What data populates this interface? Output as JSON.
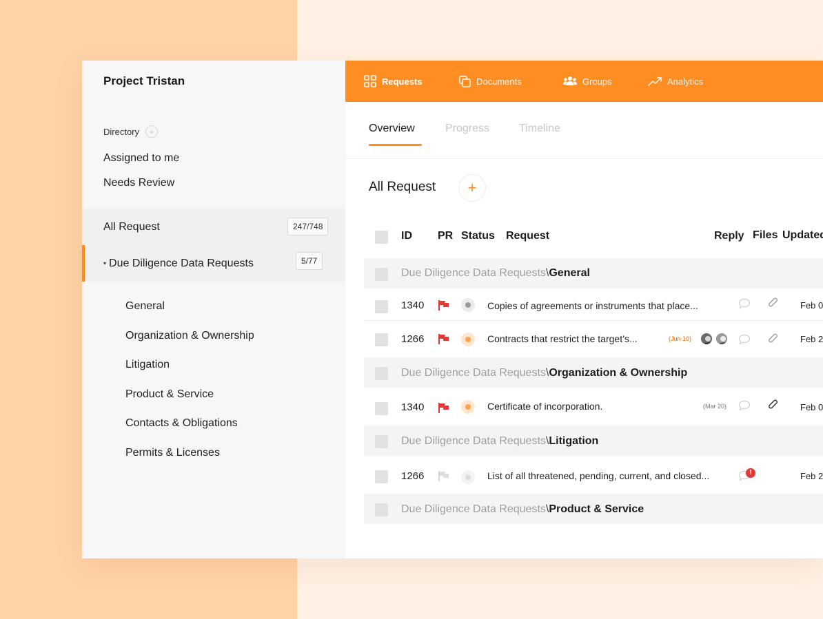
{
  "sidebar": {
    "project_title": "Project Tristan",
    "directory_label": "Directory",
    "directory_add_icon": "+",
    "links": [
      "Assigned to me",
      "Needs Review"
    ],
    "all_request": {
      "label": "All Request",
      "count": "247/748"
    },
    "due_diligence": {
      "label": "Due Diligence Data Requests",
      "count": "5/77",
      "caret": "▾"
    },
    "sub_items": [
      "General",
      "Organization & Ownership",
      "Litigation",
      "Product & Service",
      "Contacts & Obligations",
      "Permits & Licenses"
    ]
  },
  "topnav": {
    "accent_color": "#ff8e22",
    "items": [
      {
        "label": "Requests",
        "icon": "grid-icon"
      },
      {
        "label": "Documents",
        "icon": "documents-icon"
      },
      {
        "label": "Groups",
        "icon": "groups-icon"
      },
      {
        "label": "Analytics",
        "icon": "analytics-icon"
      }
    ]
  },
  "tabs": [
    "Overview",
    "Progress",
    "Timeline"
  ],
  "main": {
    "section_title": "All Request",
    "add_button": "+"
  },
  "table": {
    "headers": {
      "id": "ID",
      "pr": "PR",
      "status": "Status",
      "request": "Request",
      "reply": "Reply",
      "files": "Files",
      "updated": "Updated"
    },
    "group_prefix": "Due Diligence Data Requests",
    "group_separator": "\\",
    "groups": [
      "General",
      "Organization & Ownership",
      "Litigation",
      "Product & Service"
    ],
    "rows": [
      {
        "id": "1340",
        "flag": "red",
        "status": "grey",
        "request": "Copies of agreements or instruments that place...",
        "due": "",
        "updated": "Feb 0"
      },
      {
        "id": "1266",
        "flag": "red",
        "status": "orange",
        "request": "Contracts that restrict the target’s...",
        "due": "(Jun 10)",
        "updated": "Feb 2"
      },
      {
        "id": "1340",
        "flag": "red",
        "status": "orange",
        "request": "Certificate of incorporation.",
        "due": "(Mar 20)",
        "updated": "Feb 0"
      },
      {
        "id": "1266",
        "flag": "grey",
        "status": "light",
        "request": "List of all threatened, pending, current, and closed...",
        "due": "",
        "updated": "Feb 2",
        "alert": "!"
      }
    ]
  }
}
